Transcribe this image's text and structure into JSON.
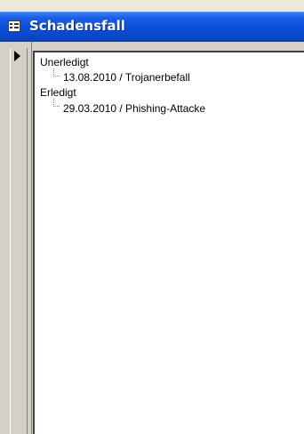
{
  "window": {
    "title": "Schadensfall",
    "title_icon": "form-icon"
  },
  "record_selector": {
    "icon": "current-record-arrow-icon"
  },
  "tree": {
    "groups": [
      {
        "label": "Unerledigt",
        "children": [
          {
            "label": "13.08.2010 / Trojanerbefall"
          }
        ]
      },
      {
        "label": "Erledigt",
        "children": [
          {
            "label": "29.03.2010 / Phishing-Attacke"
          }
        ]
      }
    ]
  },
  "colors": {
    "titlebar": "#0a4fd8",
    "chrome": "#d4d0c8",
    "tree_background": "#ffffff"
  }
}
